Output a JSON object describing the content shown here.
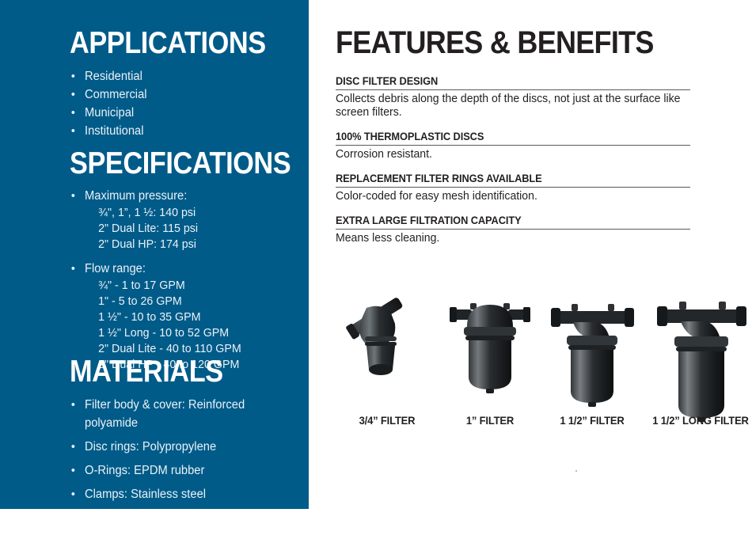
{
  "theme": {
    "panel_blue": "#005B89",
    "ink": "#231f20",
    "rule_gray": "#58595b"
  },
  "panel": {
    "applications": {
      "title": "APPLICATIONS",
      "items": [
        "Residential",
        "Commercial",
        "Municipal",
        "Institutional"
      ]
    },
    "specifications": {
      "title": "SPECIFICATIONS",
      "groups": [
        {
          "label": "Maximum pressure:",
          "lines": [
            "¾\", 1”, 1 ½: 140 psi",
            "2\" Dual Lite: 115 psi",
            "2\" Dual HP: 174 psi"
          ]
        },
        {
          "label": "Flow range:",
          "lines": [
            "¾\" - 1 to 17 GPM",
            "1\" - 5 to 26 GPM",
            "1 ½\" - 10 to 35 GPM",
            "1 ½\" Long - 10 to 52 GPM",
            "2\" Dual Lite - 40 to 110 GPM",
            "2\" Dual HP - 40 to 120 GPM"
          ]
        }
      ]
    },
    "materials": {
      "title": "MATERIALS",
      "items": [
        {
          "line1": "Filter body & cover: Reinforced",
          "line2": "polyamide"
        },
        {
          "line1": "Disc rings: Polypropylene",
          "line2": ""
        },
        {
          "line1": "O-Rings: EPDM rubber",
          "line2": ""
        },
        {
          "line1": "Clamps: Stainless steel",
          "line2": ""
        }
      ]
    },
    "bullet_glyph": "•"
  },
  "features": {
    "title": "FEATURES & BENEFITS",
    "blocks": [
      {
        "heading": "DISC FILTER DESIGN",
        "body": "Collects debris along the depth of the discs, not just at the surface like screen filters."
      },
      {
        "heading": "100% THERMOPLASTIC DISCS",
        "body": "Corrosion resistant."
      },
      {
        "heading": "REPLACEMENT FILTER RINGS AVAILABLE",
        "body": "Color-coded for easy mesh identification."
      },
      {
        "heading": "EXTRA LARGE FILTRATION CAPACITY",
        "body": "Means less cleaning."
      }
    ]
  },
  "products": [
    {
      "caption": "3/4” FILTER",
      "icon": "y-filter-photo"
    },
    {
      "caption": "1” FILTER",
      "icon": "inline-filter-photo"
    },
    {
      "caption": "1 1/2” FILTER",
      "icon": "angle-filter-photo"
    },
    {
      "caption": "1 1/2” LONG FILTER",
      "icon": "long-filter-photo"
    }
  ]
}
